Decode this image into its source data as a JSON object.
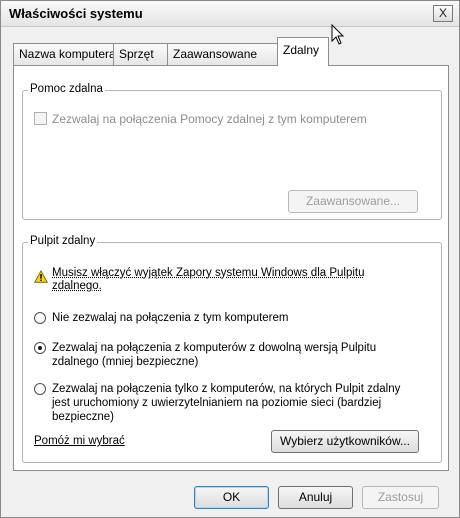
{
  "window": {
    "title": "Właściwości systemu",
    "close_label": "X"
  },
  "tabs": [
    {
      "label": "Nazwa komputera"
    },
    {
      "label": "Sprzęt"
    },
    {
      "label": "Zaawansowane"
    },
    {
      "label": "Zdalny",
      "active": true
    }
  ],
  "remote_assistance": {
    "group_label": "Pomoc zdalna",
    "checkbox_label": "Zezwalaj na połączenia Pomocy zdalnej z tym komputerem",
    "checked": false,
    "advanced_button": "Zaawansowane..."
  },
  "remote_desktop": {
    "group_label": "Pulpit zdalny",
    "warning": "Musisz włączyć wyjątek Zapory systemu Windows dla Pulpitu zdalnego.",
    "options": [
      {
        "label": "Nie zezwalaj na połączenia z tym komputerem",
        "checked": false
      },
      {
        "label": "Zezwalaj na połączenia z komputerów z dowolną wersją Pulpitu zdalnego (mniej bezpieczne)",
        "checked": true
      },
      {
        "label": "Zezwalaj na połączenia tylko z komputerów, na których Pulpit zdalny jest uruchomiony z uwierzytelnianiem na poziomie sieci (bardziej bezpieczne)",
        "checked": false
      }
    ],
    "help_link": "Pomóż mi wybrać",
    "select_users_button": "Wybierz użytkowników..."
  },
  "footer": {
    "ok": "OK",
    "cancel": "Anuluj",
    "apply": "Zastosuj"
  },
  "colors": {
    "disabled_text": "#8d8d8d",
    "default_button_border": "#3c7fb1",
    "warning_yellow": "#f5d10f"
  }
}
